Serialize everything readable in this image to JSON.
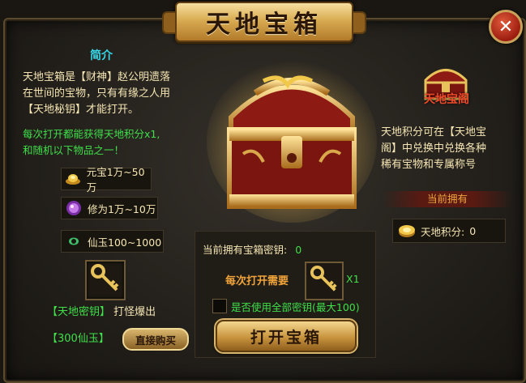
{
  "window": {
    "title": "天地宝箱",
    "close_symbol": "✕"
  },
  "intro": {
    "title": "简介",
    "line1_a": "天地宝箱是【财神】赵公明遗落",
    "line2": "在世间的宝物，只有有缘之人用",
    "line3": "【天地秘钥】才能打开。",
    "bonus1": "每次打开都能获得天地积分x1,",
    "bonus2": "和随机以下物品之一！"
  },
  "rewards": [
    {
      "icon": "gold-ingot-icon",
      "label": "元宝1万~50万"
    },
    {
      "icon": "cultivation-orb-icon",
      "label": "修为1万~10万"
    },
    {
      "icon": "jade-icon",
      "label": "仙玉100~1000"
    }
  ],
  "key_item": {
    "icon": "golden-key-icon",
    "name": "【天地密钥】",
    "source": "打怪爆出",
    "price": "【300仙玉】",
    "buy_label": "直接购买"
  },
  "open_panel": {
    "own_keys_label": "当前拥有宝箱密钥:",
    "own_keys_value": "0",
    "need_label": "每次打开需要",
    "need_count": "X1",
    "use_all_label": "是否使用全部密钥(最大100)",
    "use_all_checked": false,
    "open_button": "打开宝箱"
  },
  "right_panel": {
    "logo_text": "天地宝阁",
    "desc1": "天地积分可在【天地宝",
    "desc2": "阁】中兑换中兑换各种",
    "desc3": "稀有宝物和专属称号",
    "own_title": "当前拥有",
    "points_label": "天地积分:",
    "points_value": "0"
  },
  "colors": {
    "accent_gold": "#d9ac52",
    "text_green": "#3fe04a",
    "text_cyan": "#37d6e8",
    "text_orange": "#f0a43a",
    "text_pale": "#f5e6b4"
  }
}
